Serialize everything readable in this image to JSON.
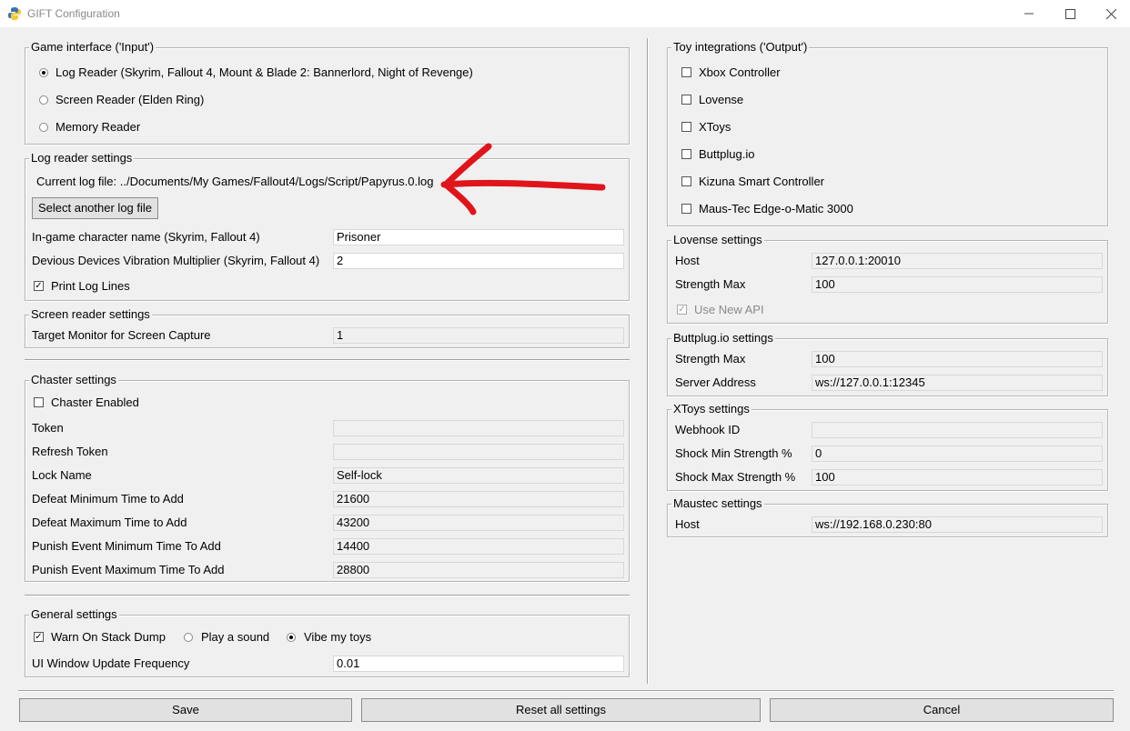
{
  "window": {
    "title": "GIFT Configuration"
  },
  "game_interface": {
    "title": "Game interface ('Input')",
    "options": [
      {
        "label": "Log Reader (Skyrim, Fallout 4, Mount & Blade 2: Bannerlord, Night of Revenge)",
        "selected": true
      },
      {
        "label": "Screen Reader (Elden Ring)",
        "selected": false
      },
      {
        "label": "Memory Reader",
        "selected": false
      }
    ]
  },
  "log_reader": {
    "title": "Log reader settings",
    "current_log_prefix": "Current log file:",
    "current_log_path": "../Documents/My Games/Fallout4/Logs/Script/Papyrus.0.log",
    "select_button": "Select another log file",
    "character_name_label": "In-game character name (Skyrim, Fallout 4)",
    "character_name_value": "Prisoner",
    "vibration_label": "Devious Devices Vibration Multiplier (Skyrim, Fallout 4)",
    "vibration_value": "2",
    "print_log_lines_label": "Print Log Lines",
    "print_log_lines_checked": true
  },
  "screen_reader": {
    "title": "Screen reader settings",
    "monitor_label": "Target Monitor for Screen Capture",
    "monitor_value": "1"
  },
  "chaster": {
    "title": "Chaster settings",
    "enabled_label": "Chaster Enabled",
    "enabled_checked": false,
    "fields": [
      {
        "label": "Token",
        "value": ""
      },
      {
        "label": "Refresh Token",
        "value": ""
      },
      {
        "label": "Lock Name",
        "value": "Self-lock"
      },
      {
        "label": "Defeat Minimum Time to Add",
        "value": "21600"
      },
      {
        "label": "Defeat Maximum Time to Add",
        "value": "43200"
      },
      {
        "label": "Punish Event Minimum Time To Add",
        "value": "14400"
      },
      {
        "label": "Punish Event Maximum Time To Add",
        "value": "28800"
      }
    ]
  },
  "general": {
    "title": "General settings",
    "warn_label": "Warn On Stack Dump",
    "warn_checked": true,
    "play_sound_label": "Play a sound",
    "vibe_label": "Vibe my toys",
    "vibe_selected": true,
    "ui_freq_label": "UI Window Update Frequency",
    "ui_freq_value": "0.01"
  },
  "toys": {
    "title": "Toy integrations ('Output')",
    "items": [
      {
        "label": "Xbox Controller",
        "checked": false
      },
      {
        "label": "Lovense",
        "checked": false
      },
      {
        "label": "XToys",
        "checked": false
      },
      {
        "label": "Buttplug.io",
        "checked": false
      },
      {
        "label": "Kizuna Smart Controller",
        "checked": false
      },
      {
        "label": "Maus-Tec Edge-o-Matic 3000",
        "checked": false
      }
    ]
  },
  "lovense": {
    "title": "Lovense settings",
    "host_label": "Host",
    "host_value": "127.0.0.1:20010",
    "strength_label": "Strength Max",
    "strength_value": "100",
    "new_api_label": "Use New API",
    "new_api_checked": true
  },
  "buttplug": {
    "title": "Buttplug.io settings",
    "strength_label": "Strength Max",
    "strength_value": "100",
    "server_label": "Server Address",
    "server_value": "ws://127.0.0.1:12345"
  },
  "xtoys": {
    "title": "XToys settings",
    "webhook_label": "Webhook ID",
    "webhook_value": "",
    "shock_min_label": "Shock Min Strength %",
    "shock_min_value": "0",
    "shock_max_label": "Shock Max Strength %",
    "shock_max_value": "100"
  },
  "maustec": {
    "title": "Maustec settings",
    "host_label": "Host",
    "host_value": "ws://192.168.0.230:80"
  },
  "buttons": {
    "save": "Save",
    "reset": "Reset all settings",
    "cancel": "Cancel"
  },
  "colors": {
    "annotation_arrow": "#e0141b"
  }
}
